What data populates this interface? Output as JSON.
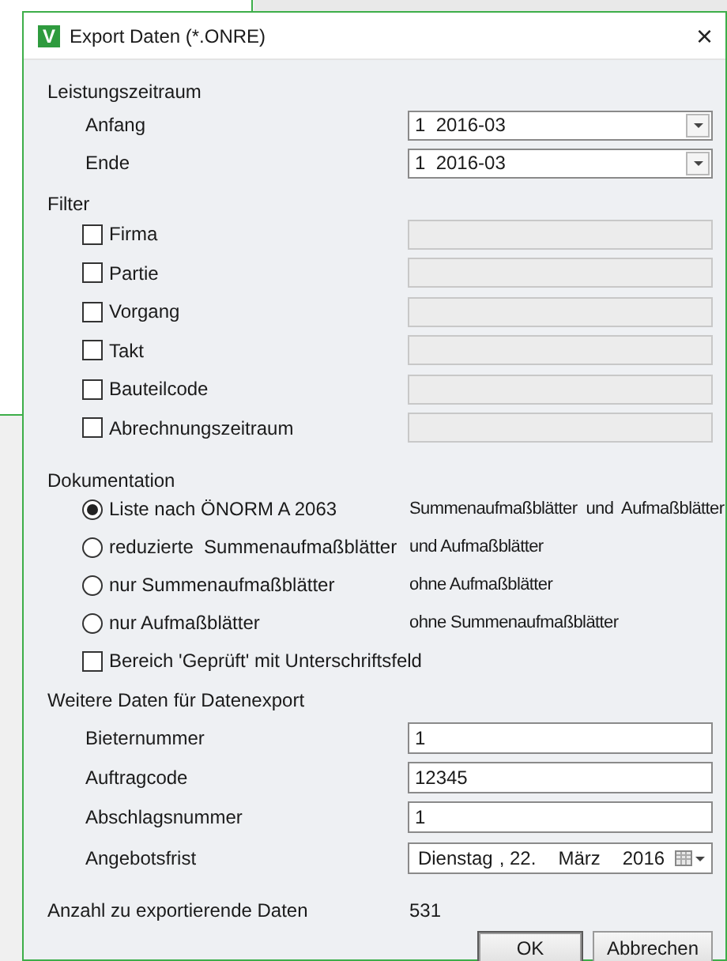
{
  "window": {
    "logo_letter": "V",
    "title": "Export Daten (*.ONRE)",
    "close": "×"
  },
  "leistungszeitraum": {
    "label": "Leistungszeitraum",
    "fields": [
      {
        "label": "Anfang",
        "value": "1  2016-03"
      },
      {
        "label": "Ende",
        "value": "1  2016-03"
      }
    ]
  },
  "filter": {
    "label": "Filter",
    "items": [
      {
        "label": "Firma",
        "checked": false,
        "field_disabled": true
      },
      {
        "label": "Partie",
        "checked": false,
        "field_disabled": true
      },
      {
        "label": "Vorgang",
        "checked": false,
        "field_disabled": true
      },
      {
        "label": "Takt",
        "checked": false,
        "field_disabled": true
      },
      {
        "label": "Bauteilcode",
        "checked": false,
        "field_disabled": true
      },
      {
        "label": "Abrechnungszeitraum",
        "checked": false,
        "field_disabled": true
      }
    ]
  },
  "dokumentation": {
    "label": "Dokumentation",
    "options": [
      {
        "label": "Liste nach ÖNORM A 2063",
        "note": "Summenaufmaßblätter  und  Aufmaßblätter",
        "selected": true
      },
      {
        "label": "reduzierte  Summenaufmaßblätter",
        "note": "und Aufmaßblätter",
        "selected": false
      },
      {
        "label": "nur Summenaufmaßblätter",
        "note": "ohne Aufmaßblätter",
        "selected": false
      },
      {
        "label": "nur Aufmaßblätter",
        "note": "ohne Summenaufmaßblätter",
        "selected": false
      }
    ],
    "checkbox": {
      "label": "Bereich 'Geprüft' mit Unterschriftsfeld",
      "checked": false
    }
  },
  "weitere_daten": {
    "label": "Weitere Daten für Datenexport",
    "fields": [
      {
        "label": "Bieternummer",
        "value": "1"
      },
      {
        "label": "Auftragcode",
        "value": "12345"
      },
      {
        "label": "Abschlagsnummer",
        "value": "1"
      }
    ],
    "date_field": {
      "label": "Angebotsfrist",
      "parts": [
        "Dienstag",
        ", 22.",
        "März",
        "2016"
      ]
    }
  },
  "count": {
    "label": "Anzahl zu exportierende Daten",
    "value": "531"
  },
  "buttons": [
    {
      "label": "OK",
      "default": true
    },
    {
      "label": "Abbrechen",
      "default": false
    }
  ]
}
